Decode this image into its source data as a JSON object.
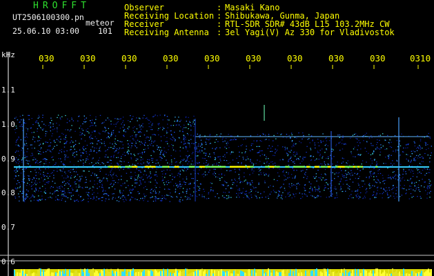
{
  "header": {
    "title": "HROFFT",
    "file_name": "UT2506100300.pn",
    "data_type": "meteor",
    "datetime": "25.06.10 03:00",
    "count": "101"
  },
  "info": {
    "observer_label": "Observer",
    "observer_value": "Masaki Kano",
    "location_label": "Receiving Location",
    "location_value": "Shibukawa, Gunma, Japan",
    "receiver_label": "Receiver",
    "receiver_value": "RTL-SDR SDR# 43dB L15 103.2MHz CW",
    "antenna_label": "Receiving Antenna",
    "antenna_value": "3el Yagi(V) Az 330 for Vladivostok",
    "colon": ":"
  },
  "axis": {
    "y_unit": "kHz",
    "y_ticks": [
      "1.1",
      "1.0",
      "0.9",
      "0.8",
      "0.7",
      "0.6"
    ],
    "x_ticks": [
      "030",
      "030",
      "030",
      "030",
      "030",
      "030",
      "030",
      "030",
      "030",
      "0310"
    ]
  },
  "colors": {
    "background": "#000000",
    "title": "#2ee02e",
    "labels": "#ffff00",
    "text": "#f2f2f2",
    "signal_low": "#1a3fff",
    "signal_mid": "#36d0ff",
    "signal_high": "#ffff00",
    "axis_line": "#ffffff"
  }
}
